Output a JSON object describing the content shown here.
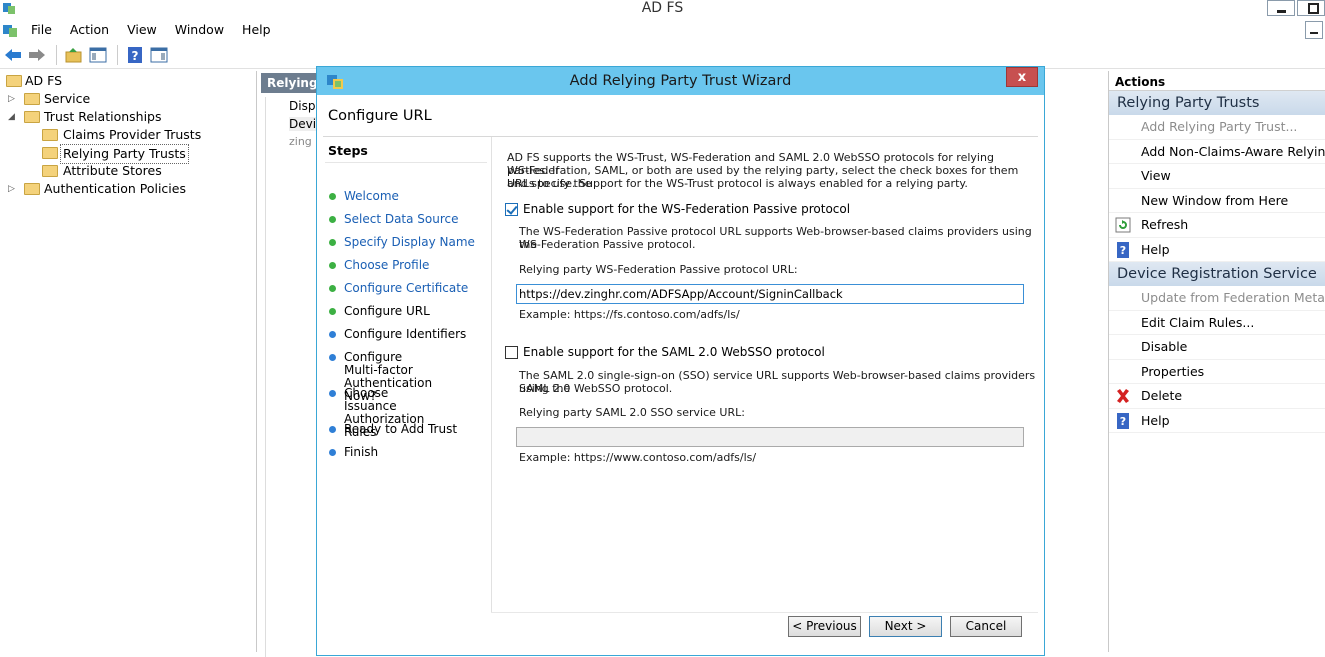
{
  "window": {
    "title": "AD FS"
  },
  "menu": [
    "File",
    "Action",
    "View",
    "Window",
    "Help"
  ],
  "tree": {
    "root": "AD FS",
    "items": [
      {
        "label": "Service",
        "level": 1,
        "expander": "collapsed"
      },
      {
        "label": "Trust Relationships",
        "level": 1,
        "expander": "expanded"
      },
      {
        "label": "Claims Provider Trusts",
        "level": 2
      },
      {
        "label": "Relying Party Trusts",
        "level": 2,
        "selected": true
      },
      {
        "label": "Attribute Stores",
        "level": 2
      },
      {
        "label": "Authentication Policies",
        "level": 1,
        "expander": "collapsed"
      }
    ]
  },
  "middle": {
    "header": "Relying P",
    "column": "Displ",
    "row1": "Devic",
    "row2": "zing"
  },
  "actions": {
    "title": "Actions",
    "sections": [
      {
        "heading": "Relying Party Trusts",
        "items": [
          {
            "label": "Add Relying Party Trust...",
            "disabled": true,
            "icon": ""
          },
          {
            "label": "Add Non-Claims-Aware Relying P...",
            "icon": ""
          },
          {
            "label": "View",
            "icon": ""
          },
          {
            "label": "New Window from Here",
            "icon": ""
          },
          {
            "label": "Refresh",
            "icon": "refresh-icon"
          },
          {
            "label": "Help",
            "icon": "help-icon"
          }
        ]
      },
      {
        "heading": "Device Registration Service",
        "items": [
          {
            "label": "Update from Federation Metadata...",
            "disabled": true,
            "icon": ""
          },
          {
            "label": "Edit Claim Rules...",
            "icon": ""
          },
          {
            "label": "Disable",
            "icon": ""
          },
          {
            "label": "Properties",
            "icon": ""
          },
          {
            "label": "Delete",
            "icon": "delete-icon"
          },
          {
            "label": "Help",
            "icon": "help-icon"
          }
        ]
      }
    ]
  },
  "dialog": {
    "title": "Add Relying Party Trust Wizard",
    "close": "x",
    "page_heading": "Configure URL",
    "steps_title": "Steps",
    "steps": [
      {
        "label": "Welcome",
        "state": "done"
      },
      {
        "label": "Select Data Source",
        "state": "done"
      },
      {
        "label": "Specify Display Name",
        "state": "done"
      },
      {
        "label": "Choose Profile",
        "state": "done"
      },
      {
        "label": "Configure Certificate",
        "state": "done"
      },
      {
        "label": "Configure URL",
        "state": "current"
      },
      {
        "label": "Configure Identifiers",
        "state": "pending"
      },
      {
        "label": "Configure Multi-factor\nAuthentication Now?",
        "state": "pending"
      },
      {
        "label": "Choose Issuance\nAuthorization Rules",
        "state": "pending"
      },
      {
        "label": "Ready to Add Trust",
        "state": "pending"
      },
      {
        "label": "Finish",
        "state": "pending"
      }
    ],
    "intro_lines": [
      "AD FS supports the WS-Trust, WS-Federation and SAML 2.0 WebSSO protocols for relying parties.  If",
      "WS-Federation, SAML, or both are used by the relying party, select the check boxes for them and specify the",
      "URLs to use.  Support for the WS-Trust protocol is always enabled for a relying party."
    ],
    "wsfed": {
      "checkbox_label": "Enable support for the WS-Federation Passive protocol",
      "checked": true,
      "desc_lines": [
        "The WS-Federation Passive protocol URL supports Web-browser-based claims providers using the",
        "WS-Federation Passive protocol."
      ],
      "field_label": "Relying party WS-Federation Passive protocol URL:",
      "value": "https://dev.zinghr.com/ADFSApp/Account/SigninCallback",
      "example": "Example: https://fs.contoso.com/adfs/ls/"
    },
    "saml": {
      "checkbox_label": "Enable support for the SAML 2.0 WebSSO protocol",
      "checked": false,
      "desc_lines": [
        "The SAML 2.0 single-sign-on (SSO) service URL supports Web-browser-based claims providers using the",
        "SAML 2.0 WebSSO protocol."
      ],
      "field_label": "Relying party SAML 2.0 SSO service URL:",
      "value": "",
      "example": "Example: https://www.contoso.com/adfs/ls/"
    },
    "buttons": {
      "previous": "< Previous",
      "next": "Next >",
      "cancel": "Cancel"
    }
  },
  "colors": {
    "dialog_title_bg": "#6ac6ee",
    "step_done": "#3cb043",
    "step_pending": "#2f7fd6",
    "link": "#1a5fb4",
    "close_bg": "#c75050"
  }
}
